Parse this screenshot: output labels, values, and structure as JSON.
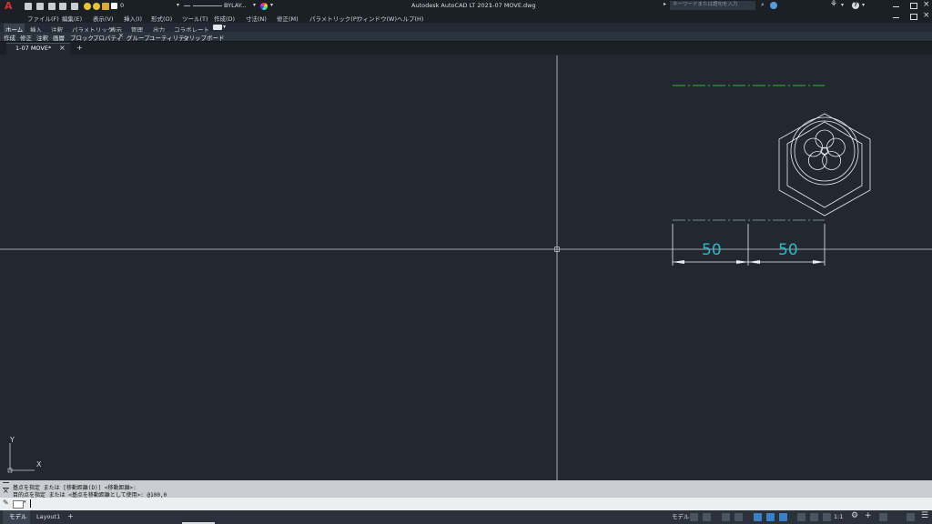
{
  "title_bar": {
    "app_title": "Autodesk AutoCAD LT 2021",
    "file_name": "1-07 MOVE.dwg",
    "layer_value": "0",
    "linetype_value": "BYLAY...",
    "search_placeholder": "キーワードまたは語句を入力",
    "help_glyph": "?"
  },
  "menu": [
    "ファイル(F)",
    "編集(E)",
    "表示(V)",
    "挿入(I)",
    "形式(O)",
    "ツール(T)",
    "作成(D)",
    "寸法(N)",
    "修正(M)",
    "パラメトリック(P)",
    "ウィンドウ(W)",
    "ヘルプ(H)"
  ],
  "ribbon_tabs": [
    "ホーム",
    "挿入",
    "注釈",
    "パラメトリック",
    "表示",
    "管理",
    "出力",
    "コラボレート"
  ],
  "ribbon_active": "ホーム",
  "ribbon_panels": [
    "作成",
    "修正",
    "注釈",
    "画層",
    "ブロック",
    "プロパティ",
    "グループ",
    "ユーティリティ",
    "クリップボード"
  ],
  "doc_tab": {
    "label": "1-07 MOVE*",
    "close": "×",
    "new": "+"
  },
  "drawing": {
    "dim_left": "50",
    "dim_right": "50",
    "ucs_x": "X",
    "ucs_y": "Y"
  },
  "command": {
    "history": [
      "基点を指定 または [移動距離(D)] <移動距離>:",
      "目的点を指定 または <基点を移動距離として使用>: @100,0"
    ],
    "prompt": ""
  },
  "layout_tabs": [
    "モデル",
    "Layout1"
  ],
  "layout_add": "+",
  "status": {
    "mode": "モデル",
    "scale": "1:1"
  },
  "colors": {
    "canvas": "#212830",
    "dimension": "#2fb8c4",
    "center_line": "#3fae3f",
    "geometry": "#e9edf0"
  }
}
